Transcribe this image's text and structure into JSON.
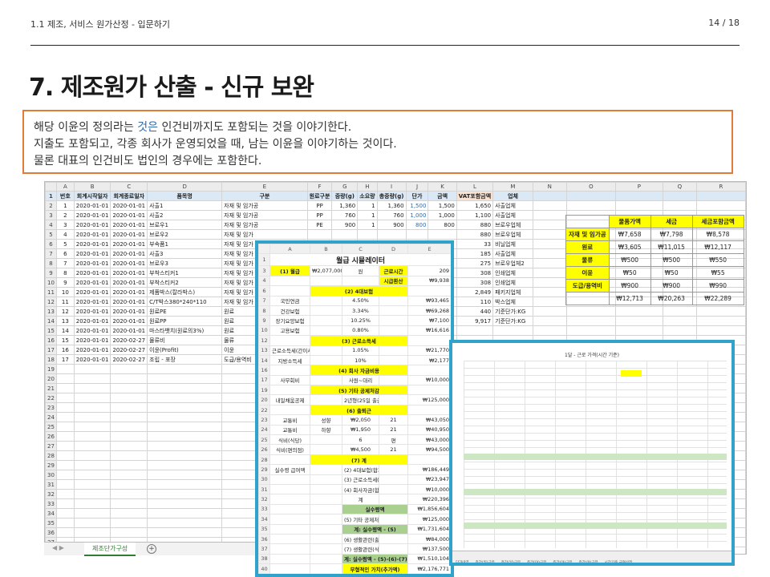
{
  "header": {
    "breadcrumb": "1.1 제조, 서비스 원가산정 - 입문하기",
    "page": "14 / 18"
  },
  "title": "7. 제조원가 산출 - 신규 보완",
  "note": {
    "line1_a": "해당 이윤의 정의라는 ",
    "line1_hl": "것은",
    "line1_b": " 인건비까지도 포함되는 것을 이야기한다.",
    "line2": "지출도 포함되고, 각종 회사가 운영되었을 때, 남는 이윤을 이야기하는 것이다.",
    "line3": "물론 대표의 인건비도 법인의 경우에는 포함한다."
  },
  "sheet": {
    "col_letters": [
      "A",
      "B",
      "C",
      "D",
      "E",
      "F",
      "G",
      "H",
      "I",
      "J",
      "K",
      "L",
      "M",
      "N",
      "O",
      "P",
      "Q",
      "R"
    ],
    "header_row": [
      "번호",
      "회계시작일자",
      "회계종료일자",
      "품목명",
      "구분",
      "원료구분",
      "중량(g)",
      "소요량",
      "총중량(g)",
      "단가",
      "금액",
      "VAT포함금액",
      "업체"
    ],
    "rows": [
      [
        "1",
        "2020-01-01",
        "2020-01-01",
        "사출1",
        "자재 및 임가공",
        "PP",
        "1,360",
        "1",
        "1,360",
        "1,500",
        "1,500",
        "1,650",
        "사출업체"
      ],
      [
        "2",
        "2020-01-01",
        "2020-01-01",
        "사출2",
        "자재 및 임가공",
        "PP",
        "760",
        "1",
        "760",
        "1,000",
        "1,000",
        "1,100",
        "사출업체"
      ],
      [
        "3",
        "2020-01-01",
        "2020-01-01",
        "브로우1",
        "자재 및 임가공",
        "PE",
        "900",
        "1",
        "900",
        "800",
        "800",
        "880",
        "브로우업체"
      ],
      [
        "4",
        "2020-01-01",
        "2020-01-01",
        "브로우2",
        "자재 및 임가",
        "",
        "",
        "",
        "",
        "",
        "",
        "880",
        "브로우업체"
      ],
      [
        "5",
        "2020-01-01",
        "2020-01-01",
        "부속품1",
        "자재 및 임가",
        "",
        "",
        "",
        "",
        "",
        "",
        "33",
        "비닐업체"
      ],
      [
        "6",
        "2020-01-01",
        "2020-01-01",
        "사출3",
        "자재 및 임가",
        "",
        "",
        "",
        "",
        "",
        "",
        "185",
        "사출업체"
      ],
      [
        "7",
        "2020-01-01",
        "2020-01-01",
        "브로우3",
        "자재 및 임가",
        "",
        "",
        "",
        "",
        "",
        "",
        "275",
        "브로우업체2"
      ],
      [
        "8",
        "2020-01-01",
        "2020-01-01",
        "부착스티커1",
        "자재 및 임가",
        "",
        "",
        "",
        "",
        "",
        "",
        "308",
        "인쇄업체"
      ],
      [
        "9",
        "2020-01-01",
        "2020-01-01",
        "부착스티커2",
        "자재 및 임가",
        "",
        "",
        "",
        "",
        "",
        "",
        "308",
        "인쇄업체"
      ],
      [
        "10",
        "2020-01-01",
        "2020-01-01",
        "제품박스(칼라박스)",
        "자재 및 임가",
        "",
        "",
        "",
        "",
        "",
        "",
        "2,849",
        "패키지업체"
      ],
      [
        "11",
        "2020-01-01",
        "2020-01-01",
        "C/T박스380*240*110",
        "자재 및 임가",
        "",
        "",
        "",
        "",
        "",
        "",
        "110",
        "박스업체"
      ],
      [
        "12",
        "2020-01-01",
        "2020-01-01",
        "원료PE",
        "원료",
        "",
        "",
        "",
        "",
        "",
        "",
        "440",
        "기준단가:KG"
      ],
      [
        "13",
        "2020-01-01",
        "2020-01-01",
        "원료PP",
        "원료",
        "",
        "",
        "",
        "",
        "",
        "",
        "9,917",
        "기준단가:KG"
      ],
      [
        "14",
        "2020-01-01",
        "2020-01-01",
        "마스타뱃치(원료의3%)",
        "원료",
        "",
        "",
        "",
        "",
        "",
        "",
        "",
        ""
      ],
      [
        "15",
        "2020-01-01",
        "2020-02-27",
        "물류비",
        "물류",
        "",
        "",
        "",
        "",
        "",
        "",
        "",
        ""
      ],
      [
        "16",
        "2020-01-01",
        "2020-02-27",
        "이윤(Profit)",
        "이윤",
        "",
        "",
        "",
        "",
        "",
        "",
        "",
        ""
      ],
      [
        "17",
        "2020-01-01",
        "2020-02-27",
        "조립 - 포장",
        "도급/용역비",
        "",
        "",
        "",
        "",
        "",
        "",
        "",
        ""
      ]
    ],
    "tab_label": "제조단가구성",
    "add_tab": "+"
  },
  "summary": {
    "headers": [
      "물품가액",
      "세금",
      "세금포함금액"
    ],
    "rows": [
      {
        "label": "자재 및 임가공",
        "v": [
          "₩7,658",
          "₩7,798",
          "₩8,578"
        ]
      },
      {
        "label": "원료",
        "v": [
          "₩3,605",
          "₩11,015",
          "₩12,117"
        ]
      },
      {
        "label": "물류",
        "v": [
          "₩500",
          "₩500",
          "₩550"
        ]
      },
      {
        "label": "이윤",
        "v": [
          "₩50",
          "₩50",
          "₩55"
        ]
      },
      {
        "label": "도급/용역비",
        "v": [
          "₩900",
          "₩900",
          "₩990"
        ]
      }
    ],
    "totals": [
      "₩12,713",
      "₩20,263",
      "₩22,289"
    ]
  },
  "payroll": {
    "col_letters": [
      "A",
      "B",
      "C",
      "D",
      "E"
    ],
    "title": "월급 시뮬레이터",
    "rows": [
      {
        "n": "3",
        "cells": [
          "(1) 월급",
          "₩2,077,000",
          "원",
          "근로시간",
          "209"
        ],
        "hl": [
          0,
          3
        ]
      },
      {
        "n": "4",
        "cells": [
          "",
          "",
          "",
          "시급환산",
          "₩9,938"
        ],
        "hl": [
          3
        ]
      },
      {
        "n": "6",
        "sec": "(2) 4대보험"
      },
      {
        "n": "7",
        "cells": [
          "국민연금",
          "",
          "4.50%",
          "",
          "₩93,465"
        ]
      },
      {
        "n": "8",
        "cells": [
          "건강보험",
          "",
          "3.34%",
          "",
          "₩69,268"
        ]
      },
      {
        "n": "9",
        "cells": [
          "장기요양보험",
          "",
          "10.25%",
          "",
          "₩7,100"
        ]
      },
      {
        "n": "10",
        "cells": [
          "고용보험",
          "",
          "0.80%",
          "",
          "₩16,616"
        ]
      },
      {
        "n": "12",
        "sec": "(3) 근로소득세"
      },
      {
        "n": "13",
        "cells": [
          "근로소득세(간이세액)",
          "",
          "1.05%",
          "",
          "₩21,770"
        ]
      },
      {
        "n": "14",
        "cells": [
          "지방소득세",
          "",
          "10%",
          "",
          "₩2,177"
        ]
      },
      {
        "n": "16",
        "sec": "(4) 회사 자금비용"
      },
      {
        "n": "17",
        "cells": [
          "사무회비",
          "",
          "사원~대리",
          "",
          "₩10,000"
        ]
      },
      {
        "n": "19",
        "sec": "(5) 기타 공제처감"
      },
      {
        "n": "20",
        "cells": [
          "내일채움공제",
          "",
          "2년형(25일 출금예정)",
          "",
          "₩125,000"
        ]
      },
      {
        "n": "22",
        "sec": "(6) 출퇴근"
      },
      {
        "n": "23",
        "cells": [
          "교통비",
          "성향",
          "₩2,050",
          "21",
          "₩43,050"
        ]
      },
      {
        "n": "24",
        "cells": [
          "교통비",
          "하향",
          "₩1,950",
          "21",
          "₩40,950"
        ]
      },
      {
        "n": "25",
        "cells": [
          "식비(식당)",
          "",
          "6",
          "편",
          "₩43,000"
        ]
      },
      {
        "n": "26",
        "cells": [
          "식비(편의점)",
          "",
          "₩4,500",
          "21",
          "₩94,500"
        ]
      },
      {
        "n": "28",
        "sec": "(7) 계"
      },
      {
        "n": "29",
        "cells": [
          "실수령 급여액",
          "",
          "(2) 4대보험(합계)",
          "",
          "₩186,449"
        ]
      },
      {
        "n": "30",
        "cells": [
          "",
          "",
          "(3) 근로소득세(합계)",
          "",
          "₩23,947"
        ]
      },
      {
        "n": "31",
        "cells": [
          "",
          "",
          "(4) 회사자금(합계)",
          "",
          "₩10,000"
        ]
      },
      {
        "n": "32",
        "cells": [
          "",
          "",
          "계",
          "",
          "₩220,396"
        ]
      },
      {
        "n": "33",
        "grn": [
          "실수령액",
          "₩1,856,604"
        ]
      },
      {
        "n": "34",
        "cells": [
          "",
          "",
          "(5) 기타 공제처감",
          "",
          "₩125,000"
        ]
      },
      {
        "n": "35",
        "grn": [
          "계: 실수령액 - (5)",
          "₩1,731,604"
        ]
      },
      {
        "n": "36",
        "cells": [
          "",
          "",
          "(6) 생활관련(출퇴근)",
          "",
          "₩84,000"
        ]
      },
      {
        "n": "37",
        "cells": [
          "",
          "",
          "(7) 생활관련(식비)",
          "",
          "₩137,500"
        ]
      },
      {
        "n": "38",
        "grn": [
          "계: 실수령액 - (5)-(6)-(7)",
          "₩1,510,104"
        ]
      },
      {
        "n": "40",
        "yel": [
          "무형적인 가치(추가액)",
          "₩2,176,771"
        ]
      }
    ]
  },
  "worksheet2": {
    "title": "1달 - 근로 가격(시간 기준)",
    "tabs": [
      "단가내역",
      "주간(일)근무",
      "주간(일)근무",
      "주간(야)근무",
      "주간(야)근무",
      "주간(야)근무",
      "시간기준 급여산정"
    ]
  }
}
